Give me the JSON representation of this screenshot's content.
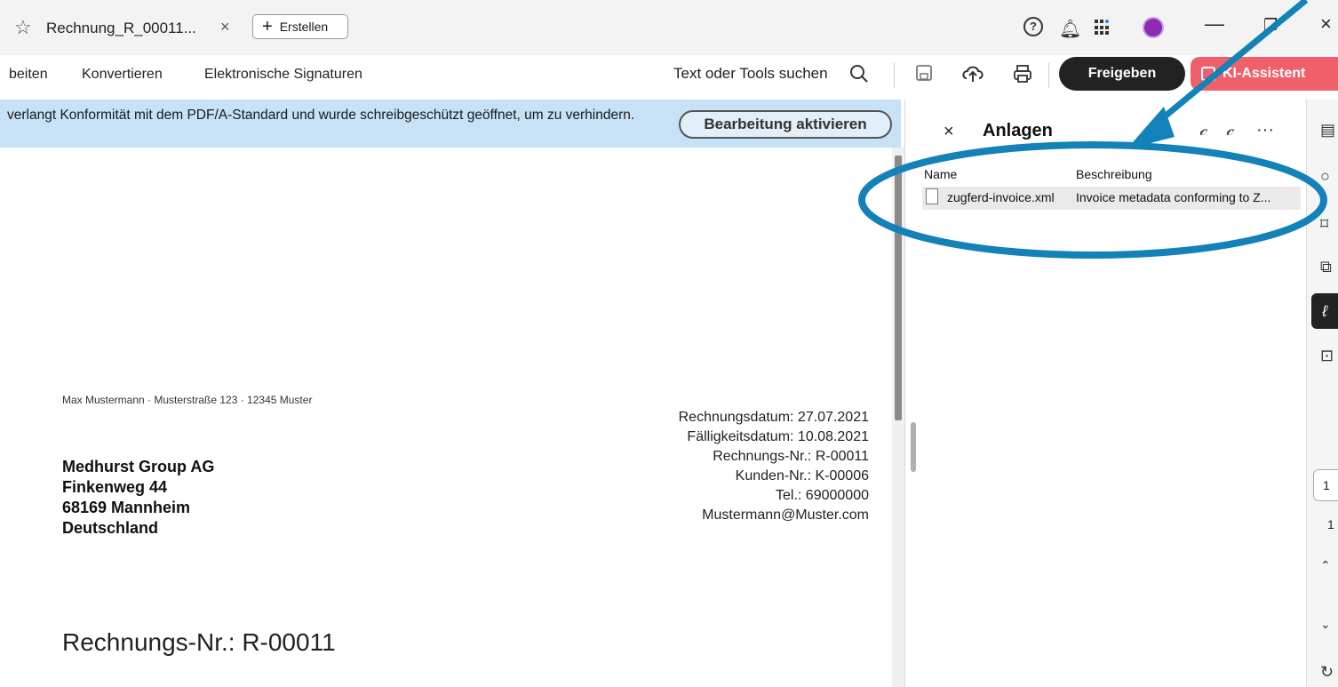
{
  "tab": {
    "title": "Rechnung_R_00011...",
    "close": "×",
    "star_icon": "star-outline-icon"
  },
  "create_button": {
    "label": "Erstellen",
    "plus": "+"
  },
  "window_controls": {
    "minimize": "—",
    "restore": "❐",
    "close": "×"
  },
  "top_icons": {
    "help": "?",
    "bell": "bell-icon",
    "apps": "apps-icon",
    "avatar": "avatar-icon"
  },
  "menu": [
    "beiten",
    "Konvertieren",
    "Elektronische Signaturen"
  ],
  "search_label": "Text oder Tools suchen",
  "share_button": "Freigeben",
  "ai_button": "KI-Assistent",
  "banner": {
    "text": "verlangt Konformität mit dem PDF/A-Standard und wurde schreibgeschützt geöffnet, um zu verhindern.",
    "button": "Bearbeitung aktivieren"
  },
  "document": {
    "sender": "Max Mustermann · Musterstraße 123 · 12345 Muster",
    "recipient": [
      "Medhurst Group AG",
      "Finkenweg 44",
      "68169 Mannheim",
      "Deutschland"
    ],
    "meta": [
      "Rechnungsdatum: 27.07.2021",
      "Fälligkeitsdatum: 10.08.2021",
      "Rechnungs-Nr.: R-00011",
      "Kunden-Nr.: K-00006",
      "Tel.: 69000000",
      "Mustermann@Muster.com"
    ],
    "heading": "Rechnungs-Nr.: R-00011"
  },
  "panel": {
    "close": "×",
    "title": "Anlagen",
    "more": "···",
    "columns": {
      "name": "Name",
      "description": "Beschreibung"
    },
    "rows": [
      {
        "name": "zugferd-invoice.xml",
        "description": "Invoice metadata conforming to Z..."
      }
    ]
  },
  "rail": {
    "page_input": "1",
    "page_total": "1"
  },
  "annotation_color": "#1282b8"
}
